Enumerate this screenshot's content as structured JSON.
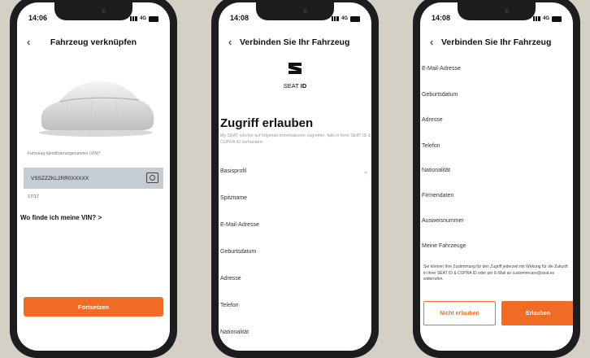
{
  "colors": {
    "accent": "#f06c24",
    "background": "#d5d0c6",
    "vin_field": "#c5ccd3"
  },
  "phone1": {
    "time": "14:06",
    "network": "4G",
    "title": "Fahrzeug verknüpfen",
    "vin_label": "Fahrzeug-Identifizierungsnummer (VIN)*",
    "vin_value": "VSSZZZKL2RR0XXXXX",
    "counter": "17/17",
    "vin_help": "Wo finde ich meine VIN?",
    "continue_button": "Fortsetzen",
    "icons": {
      "back": "chevron-left-icon",
      "camera": "camera-icon",
      "chevron": "chevron-right-icon"
    }
  },
  "phone2": {
    "time": "14:08",
    "network": "4G",
    "title": "Verbinden Sie Ihr Fahrzeug",
    "brand_name": "SEAT",
    "brand_id": "ID",
    "heading": "Zugriff erlauben",
    "subtitle": "My SEAT möchte auf folgende Informationen zugreifen, falls in Ihrer SEAT ID & CUPRA ID vorhanden:",
    "items": [
      "Basisprofil",
      "Spitzname",
      "E-Mail-Adresse",
      "Geburtsdatum",
      "Adresse",
      "Telefon",
      "Nationalität"
    ]
  },
  "phone3": {
    "time": "14:08",
    "network": "4G",
    "title": "Verbinden Sie Ihr Fahrzeug",
    "items": [
      "E-Mail-Adresse",
      "Geburtsdatum",
      "Adresse",
      "Telefon",
      "Nationalität",
      "Firmendaten",
      "Ausweisnummer",
      "Meine Fahrzeuge"
    ],
    "footnote": "Sie können Ihre Zustimmung für den Zugriff jederzeit mit Wirkung für die Zukunft in Ihrer SEAT ID & CUPRA ID oder per E-Mail an customercare@seat.es widerrufen.",
    "deny_button": "Nicht erlauben",
    "allow_button": "Erlauben"
  }
}
